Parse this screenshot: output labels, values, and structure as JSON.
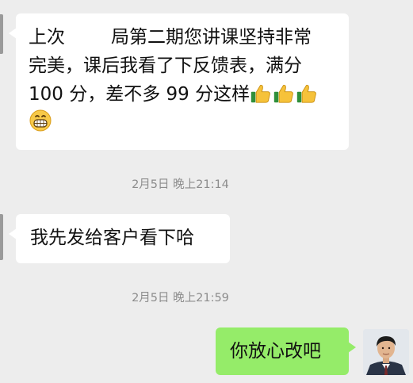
{
  "messages": [
    {
      "line1_start": "上次",
      "line1_end": "局第二期您讲课坚持非常",
      "line2": "完美，课后我看了下反馈表，满分",
      "line3": "100 分，差不多 99 分这样"
    },
    {
      "text": "我先发给客户看下哈"
    },
    {
      "text": "你放心改吧"
    }
  ],
  "timestamps": [
    "2月5日 晚上21:14",
    "2月5日 晚上21:59"
  ],
  "icons": {
    "thumbs": "thumbs-up-emoji",
    "grin": "grinning-emoji",
    "avatar": "user-avatar"
  },
  "colors": {
    "background": "#ededed",
    "incoming": "#ffffff",
    "outgoing": "#95ec69"
  }
}
